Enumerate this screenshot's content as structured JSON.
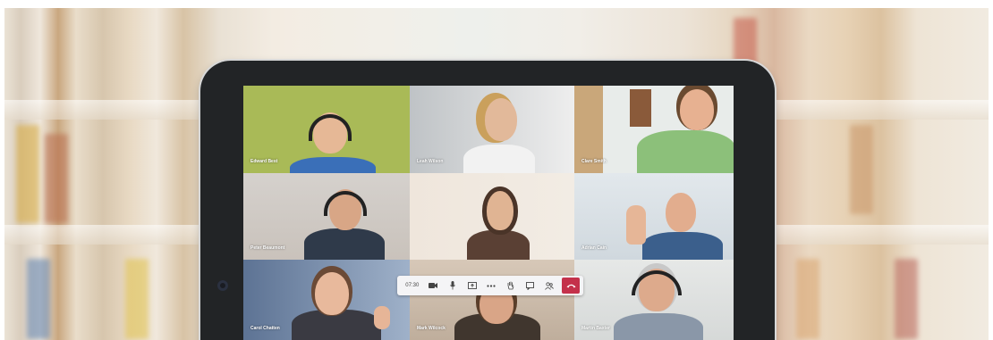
{
  "meeting": {
    "timer": "07:30",
    "participants": [
      {
        "name": "Edward Best",
        "bg": "#a9ba57"
      },
      {
        "name": "Leah Wilson",
        "bg": "#dcdcdc"
      },
      {
        "name": "Clare Smith",
        "bg": "#dfe4e2"
      },
      {
        "name": "Peter Beaumont",
        "bg": "#d8d3cf"
      },
      {
        "name": "",
        "bg": "#e9dfd5"
      },
      {
        "name": "Adrian Cain",
        "bg": "#dfe6ea"
      },
      {
        "name": "Carol Chatten",
        "bg": "#7d8fa8"
      },
      {
        "name": "Mark Wilcock",
        "bg": "#c9b8a6"
      },
      {
        "name": "Martin Baxter",
        "bg": "#dfe1e0"
      }
    ]
  },
  "toolbar": {
    "icons": [
      "video-camera-icon",
      "microphone-icon",
      "share-screen-icon",
      "more-options-icon",
      "raise-hand-icon",
      "chat-icon",
      "participants-icon",
      "hang-up-icon"
    ],
    "hangup_color": "#c4314b"
  }
}
